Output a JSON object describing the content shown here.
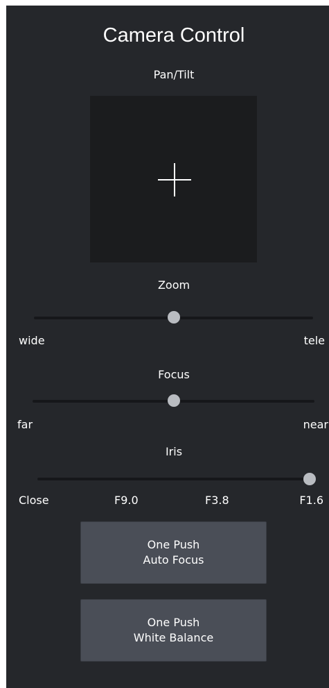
{
  "title": "Camera Control",
  "pan_tilt": {
    "label": "Pan/Tilt"
  },
  "zoom": {
    "label": "Zoom",
    "min_label": "wide",
    "max_label": "tele",
    "value": 0.5
  },
  "focus": {
    "label": "Focus",
    "min_label": "far",
    "max_label": "near",
    "value": 0.5
  },
  "iris": {
    "label": "Iris",
    "ticks": [
      "Close",
      "F9.0",
      "F3.8",
      "F1.6"
    ],
    "value": 1.0
  },
  "buttons": {
    "auto_focus": {
      "line1": "One Push",
      "line2": "Auto Focus"
    },
    "white_balance": {
      "line1": "One Push",
      "line2": "White Balance"
    }
  },
  "colors": {
    "panel_bg": "#25272b",
    "pad_bg": "#1b1c1e",
    "button_bg": "#4a4e57",
    "slider_thumb": "#b9bcc1",
    "text": "#ffffff"
  }
}
